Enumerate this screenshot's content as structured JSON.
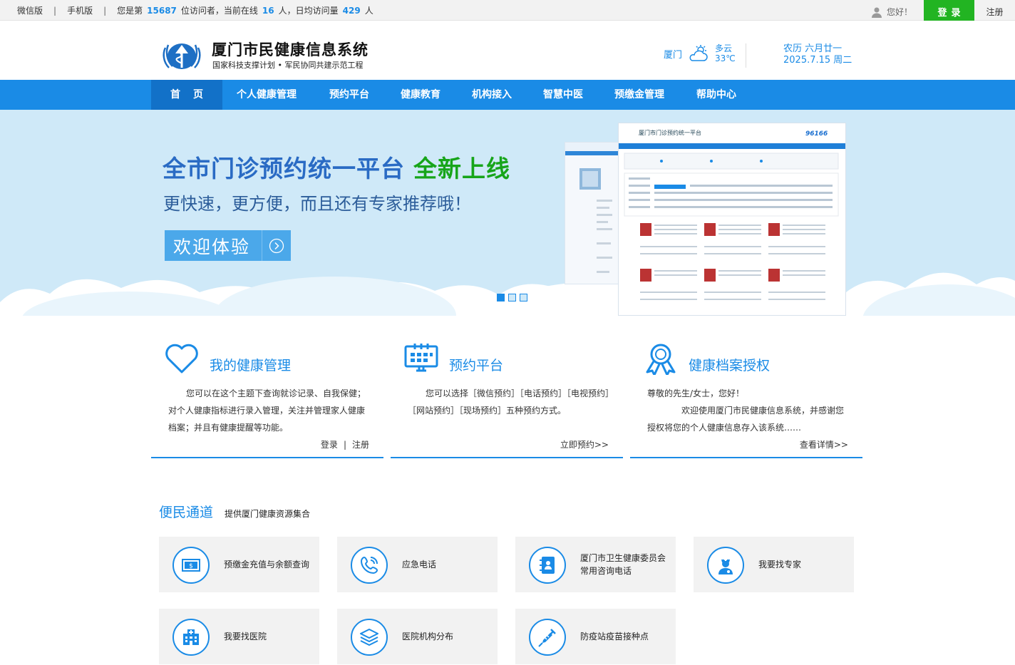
{
  "topbar": {
    "wechat": "微信版",
    "mobile": "手机版",
    "visitor_prefix": "您是第",
    "visitor_no": "15687",
    "visitor_mid": "位访问者，当前在线",
    "online": "16",
    "daily_prefix": "人，日均访问量",
    "daily": "429",
    "daily_suffix": "人",
    "hello": "您好！",
    "login": "登录",
    "register": "注册"
  },
  "header": {
    "title": "厦门市民健康信息系统",
    "subtitle": "国家科技支撑计划 • 军民协同共建示范工程",
    "city": "厦门",
    "weather": "多云",
    "temp": "33℃",
    "lunar": "农历 六月廿一",
    "date": "2025.7.15 周二"
  },
  "nav": [
    "首页",
    "个人健康管理",
    "预约平台",
    "健康教育",
    "机构接入",
    "智慧中医",
    "预缴金管理",
    "帮助中心"
  ],
  "banner": {
    "headline": "全市门诊预约统一平台",
    "headline_green": "全新上线",
    "subline": "更快速，更方便，而且还有专家推荐哦！",
    "button": "欢迎体验",
    "mock_title": "厦门市门诊预约统一平台",
    "mock_phone": "96166",
    "slide_active": 1,
    "slide_count": 3
  },
  "cards": [
    {
      "title": "我的健康管理",
      "lines": [
        "您可以在这个主题下查询就诊记录、自我保健；",
        "对个人健康指标进行录入管理，关注并管理家人健康",
        "档案；并且有健康提醒等功能。"
      ],
      "link_a": "登录",
      "link_sep": "|",
      "link_b": "注册"
    },
    {
      "title": "预约平台",
      "lines": [
        "您可以选择［微信预约］［电话预约］［电视预约］",
        "［网站预约］［现场预约］五种预约方式。"
      ],
      "link": "立即预约>>"
    },
    {
      "title": "健康档案授权",
      "lines": [
        "尊敬的先生/女士，您好！",
        "欢迎使用厦门市民健康信息系统，并感谢您",
        "授权将您的个人健康信息存入该系统……"
      ],
      "link": "查看详情>>"
    }
  ],
  "convenience": {
    "title": "便民通道",
    "subtitle": "提供厦门健康资源集合",
    "tiles": [
      {
        "label": "预缴金充值与余额查询",
        "icon": "money-icon"
      },
      {
        "label": "应急电话",
        "icon": "phone-icon"
      },
      {
        "label": "厦门市卫生健康委员会常用咨询电话",
        "icon": "contact-book-icon"
      },
      {
        "label": "我要找专家",
        "icon": "doctor-icon"
      },
      {
        "label": "我要找医院",
        "icon": "hospital-icon"
      },
      {
        "label": "医院机构分布",
        "icon": "layers-icon"
      },
      {
        "label": "防疫站疫苗接种点",
        "icon": "syringe-icon"
      }
    ]
  },
  "colors": {
    "primary": "#1a8be6",
    "login_green": "#22b422",
    "banner_bg": "#cfe9f8",
    "headline_green": "#17a51a"
  }
}
